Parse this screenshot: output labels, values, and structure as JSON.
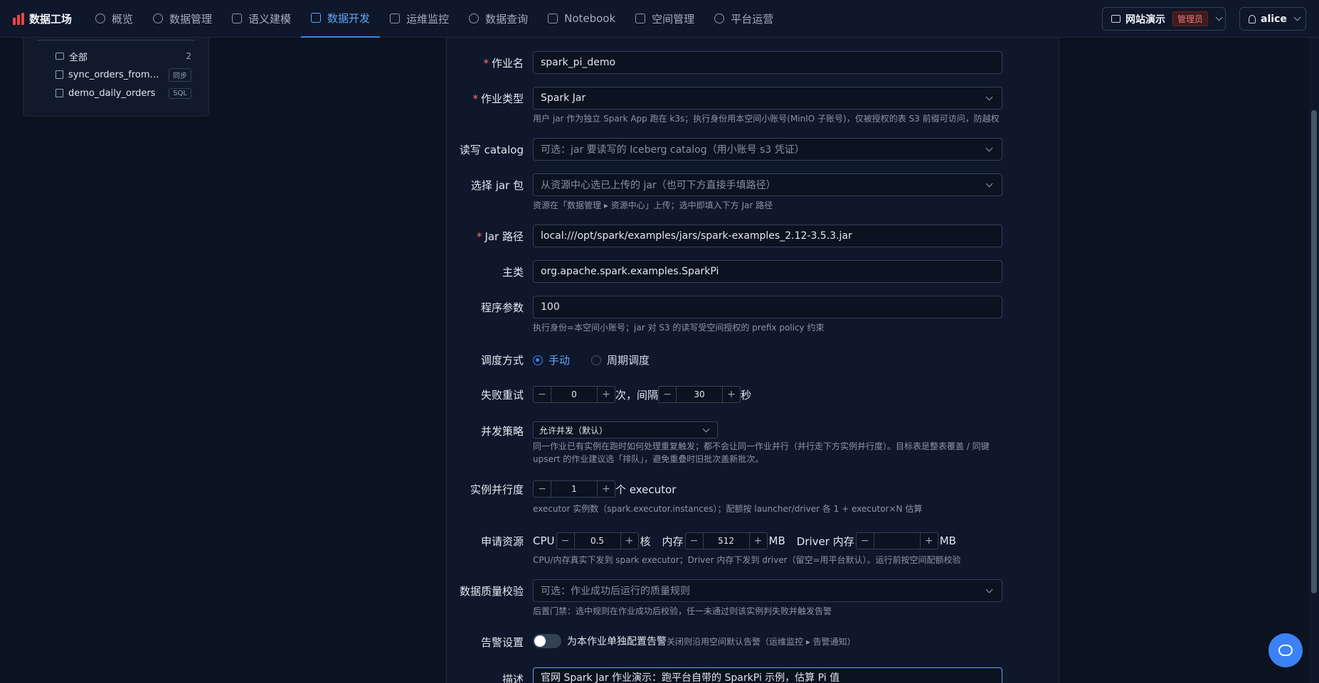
{
  "brand": {
    "name": "数据工场",
    "logo_color": "#ef4444"
  },
  "nav": [
    {
      "label": "概览",
      "icon": "gauge-icon"
    },
    {
      "label": "数据管理",
      "icon": "database-icon"
    },
    {
      "label": "语义建模",
      "icon": "sparkle-icon"
    },
    {
      "label": "数据开发",
      "icon": "code-file-icon",
      "active": true
    },
    {
      "label": "运维监控",
      "icon": "monitor-icon"
    },
    {
      "label": "数据查询",
      "icon": "search-icon"
    },
    {
      "label": "Notebook",
      "icon": "notebook-icon"
    },
    {
      "label": "空间管理",
      "icon": "building-icon"
    },
    {
      "label": "平台运营",
      "icon": "gear-icon"
    }
  ],
  "workspace": {
    "name": "网站演示",
    "role": "管理员"
  },
  "user": {
    "name": "alice"
  },
  "tree": {
    "items": [
      {
        "name": "全部",
        "count": "2",
        "icon": "box-icon"
      },
      {
        "name": "sync_orders_from_pg",
        "tag": "同步",
        "icon": "file-icon"
      },
      {
        "name": "demo_daily_orders",
        "tag": "SQL",
        "icon": "file-icon"
      }
    ]
  },
  "form": {
    "job_name": {
      "label": "作业名",
      "value": "spark_pi_demo"
    },
    "job_type": {
      "label": "作业类型",
      "value": "Spark Jar",
      "hint": "用户 jar 作为独立 Spark App 跑在 k3s；执行身份用本空间小账号(MinIO 子账号)，仅被授权的表 S3 前缀可访问，防越权"
    },
    "catalog": {
      "label": "读写 catalog",
      "placeholder": "可选：jar 要读写的 Iceberg catalog（用小账号 s3 凭证）"
    },
    "jar_select": {
      "label": "选择 jar 包",
      "placeholder": "从资源中心选已上传的 jar（也可下方直接手填路径）",
      "hint": "资源在「数据管理 ▸ 资源中心」上传；选中即填入下方 Jar 路径"
    },
    "jar_path": {
      "label": "Jar 路径",
      "value": "local:///opt/spark/examples/jars/spark-examples_2.12-3.5.3.jar"
    },
    "main_class": {
      "label": "主类",
      "value": "org.apache.spark.examples.SparkPi"
    },
    "args": {
      "label": "程序参数",
      "value": "100",
      "hint": "执行身份=本空间小账号；jar 对 S3 的读写受空间授权的 prefix policy 约束"
    },
    "schedule": {
      "label": "调度方式",
      "options": [
        "手动",
        "周期调度"
      ],
      "selected": "手动"
    },
    "retry": {
      "label": "失败重试",
      "times": "0",
      "times_unit": "次，间隔",
      "interval": "30",
      "interval_unit": "秒"
    },
    "concurrency": {
      "label": "并发策略",
      "value": "允许并发（默认）",
      "hint1": "同一作业已有实例在跑时如何处理重复触发；都不会让同一作业并行（并行走下方实例并行度）。目标表是整表覆盖 / 同键",
      "hint2": "upsert 的作业建议选「排队」，避免重叠时旧批次盖新批次。"
    },
    "parallelism": {
      "label": "实例并行度",
      "value": "1",
      "unit": "个 executor",
      "hint": "executor 实例数（spark.executor.instances）；配额按 launcher/driver 各 1 + executor×N 估算"
    },
    "resources": {
      "label": "申请资源",
      "cpu_label": "CPU",
      "cpu": "0.5",
      "cpu_unit": "核",
      "mem_label": "内存",
      "mem": "512",
      "mem_unit": "MB",
      "driver_label": "Driver 内存",
      "driver": "",
      "driver_unit": "MB",
      "hint": "CPU/内存真实下发到 spark executor；Driver 内存下发到 driver（留空=用平台默认）。运行前按空间配额校验"
    },
    "quality": {
      "label": "数据质量校验",
      "placeholder": "可选：作业成功后运行的质量规则",
      "hint": "后置门禁：选中规则在作业成功后校验，任一未通过则该实例判失败并触发告警"
    },
    "alert": {
      "label": "告警设置",
      "toggle_label": "为本作业单独配置告警",
      "hint": "关闭则沿用空间默认告警（运维监控 ▸ 告警通知）",
      "enabled": false
    },
    "description": {
      "label": "描述",
      "value": "官网 Spark Jar 作业演示：跑平台自带的 SparkPi 示例，估算 Pi 值"
    }
  }
}
